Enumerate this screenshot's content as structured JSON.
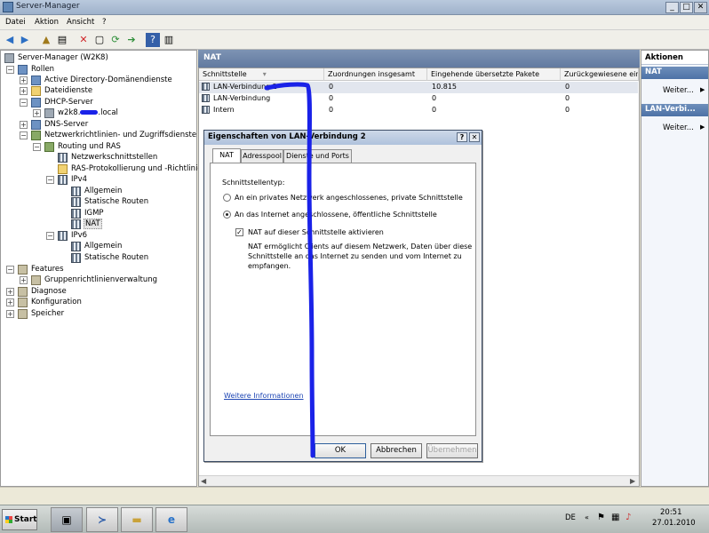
{
  "window": {
    "title": "Server-Manager",
    "min": "_",
    "max": "□",
    "close": "✕"
  },
  "menu": [
    "Datei",
    "Aktion",
    "Ansicht",
    "?"
  ],
  "tree": {
    "root": "Server-Manager (W2K8)",
    "roles": "Rollen",
    "ad": "Active Directory-Domänendienste",
    "files": "Dateidienste",
    "dhcp": "DHCP-Server",
    "dhcp_host_prefix": "w2k8.",
    "dhcp_host_suffix": ".local",
    "dns": "DNS-Server",
    "npas": "Netzwerkrichtlinien- und Zugriffsdienste",
    "rras": "Routing und RAS",
    "nics": "Netzwerkschnittstellen",
    "raslog": "RAS-Protokollierung und -Richtlinien",
    "ipv4": "IPv4",
    "general4": "Allgemein",
    "static4": "Statische Routen",
    "igmp": "IGMP",
    "nat": "NAT",
    "ipv6": "IPv6",
    "general6": "Allgemein",
    "static6": "Statische Routen",
    "features": "Features",
    "gpm": "Gruppenrichtlinienverwaltung",
    "diag": "Diagnose",
    "config": "Konfiguration",
    "storage": "Speicher"
  },
  "center": {
    "title": "NAT",
    "columns": [
      "Schnittstelle",
      "Zuordnungen insgesamt",
      "Eingehende übersetzte Pakete",
      "Zurückgewiesene ein"
    ],
    "rows": [
      [
        "LAN-Verbindung 2",
        "0",
        "10.815",
        "0"
      ],
      [
        "LAN-Verbindung",
        "0",
        "0",
        "0"
      ],
      [
        "Intern",
        "0",
        "0",
        "0"
      ]
    ]
  },
  "actions": {
    "title": "Aktionen",
    "section1": "NAT",
    "more1": "Weiter...",
    "section2": "LAN-Verbi...",
    "more2": "Weiter..."
  },
  "dialog": {
    "title": "Eigenschaften von LAN-Verbindung 2",
    "help": "?",
    "close": "✕",
    "tabs": [
      "NAT",
      "Adresspool",
      "Dienste und Ports"
    ],
    "type_label": "Schnittstellentyp:",
    "radio_private": "An ein privates Netzwerk angeschlossenes, private Schnittstelle",
    "radio_public": "An das Internet angeschlossene, öffentliche Schnittstelle",
    "check_nat": "NAT auf dieser Schnittstelle aktivieren",
    "desc_line1": "NAT ermöglicht Clients auf diesem Netzwerk, Daten über diese",
    "desc_line2": "Schnittstelle an das Internet zu senden und vom Internet zu",
    "desc_line3": "empfangen.",
    "link": "Weitere Informationen",
    "ok": "OK",
    "cancel": "Abbrechen",
    "apply": "Übernehmen"
  },
  "taskbar": {
    "start": "Start",
    "lang": "DE",
    "time": "20:51",
    "date": "27.01.2010"
  },
  "colors": {
    "annotation": "#1a22e8",
    "header": "#627aa0"
  }
}
